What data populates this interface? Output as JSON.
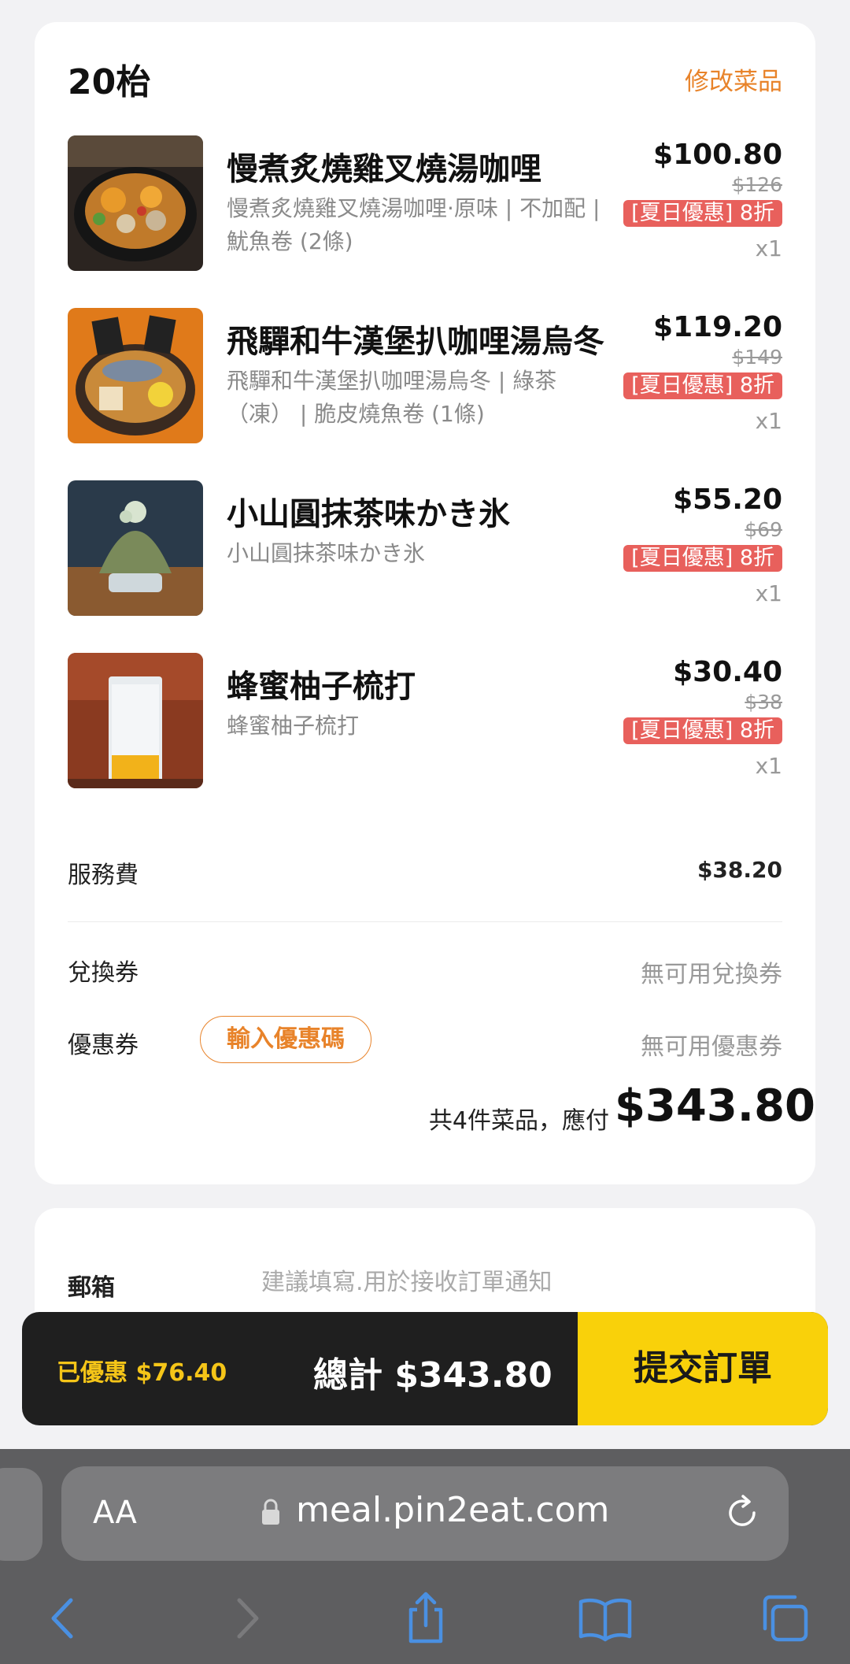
{
  "order": {
    "table": "20枱",
    "edit_label": "修改菜品",
    "items": [
      {
        "name": "慢煮炙燒雞叉燒湯咖哩",
        "desc": "慢煮炙燒雞叉燒湯咖哩·原味 | 不加配 | 魷魚卷 (2條)",
        "price": "$100.80",
        "original": "$126",
        "promo": "[夏日優惠] 8折",
        "qty": "x1"
      },
      {
        "name": "飛驒和牛漢堡扒咖哩湯烏冬",
        "desc": "飛驒和牛漢堡扒咖哩湯烏冬 | 綠茶（凍） | 脆皮燒魚卷 (1條)",
        "price": "$119.20",
        "original": "$149",
        "promo": "[夏日優惠] 8折",
        "qty": "x1"
      },
      {
        "name": "小山圓抹茶味かき氷",
        "desc": "小山圓抹茶味かき氷",
        "price": "$55.20",
        "original": "$69",
        "promo": "[夏日優惠] 8折",
        "qty": "x1"
      },
      {
        "name": "蜂蜜柚子梳打",
        "desc": "蜂蜜柚子梳打",
        "price": "$30.40",
        "original": "$38",
        "promo": "[夏日優惠] 8折",
        "qty": "x1"
      }
    ],
    "service_fee_label": "服務費",
    "service_fee": "$38.20",
    "voucher_label": "兌換券",
    "voucher_value": "無可用兌換券",
    "coupon_label": "優惠券",
    "coupon_button": "輸入優惠碼",
    "coupon_value": "無可用優惠券",
    "summary_count": "共4件菜品，應付",
    "summary_total": "$343.80"
  },
  "contact": {
    "email_label": "郵箱",
    "email_placeholder": "建議填寫.用於接收訂單通知"
  },
  "action_bar": {
    "saved": "已優惠 $76.40",
    "grand_total": "總計 $343.80",
    "submit": "提交訂單"
  },
  "browser": {
    "text_size_label": "AA",
    "url": "meal.pin2eat.com"
  },
  "colors": {
    "accent": "#e8832a",
    "promo": "#e8605c",
    "submit": "#f9d10a",
    "saved_text": "#f5c518",
    "browser_icon": "#4a90e2"
  }
}
